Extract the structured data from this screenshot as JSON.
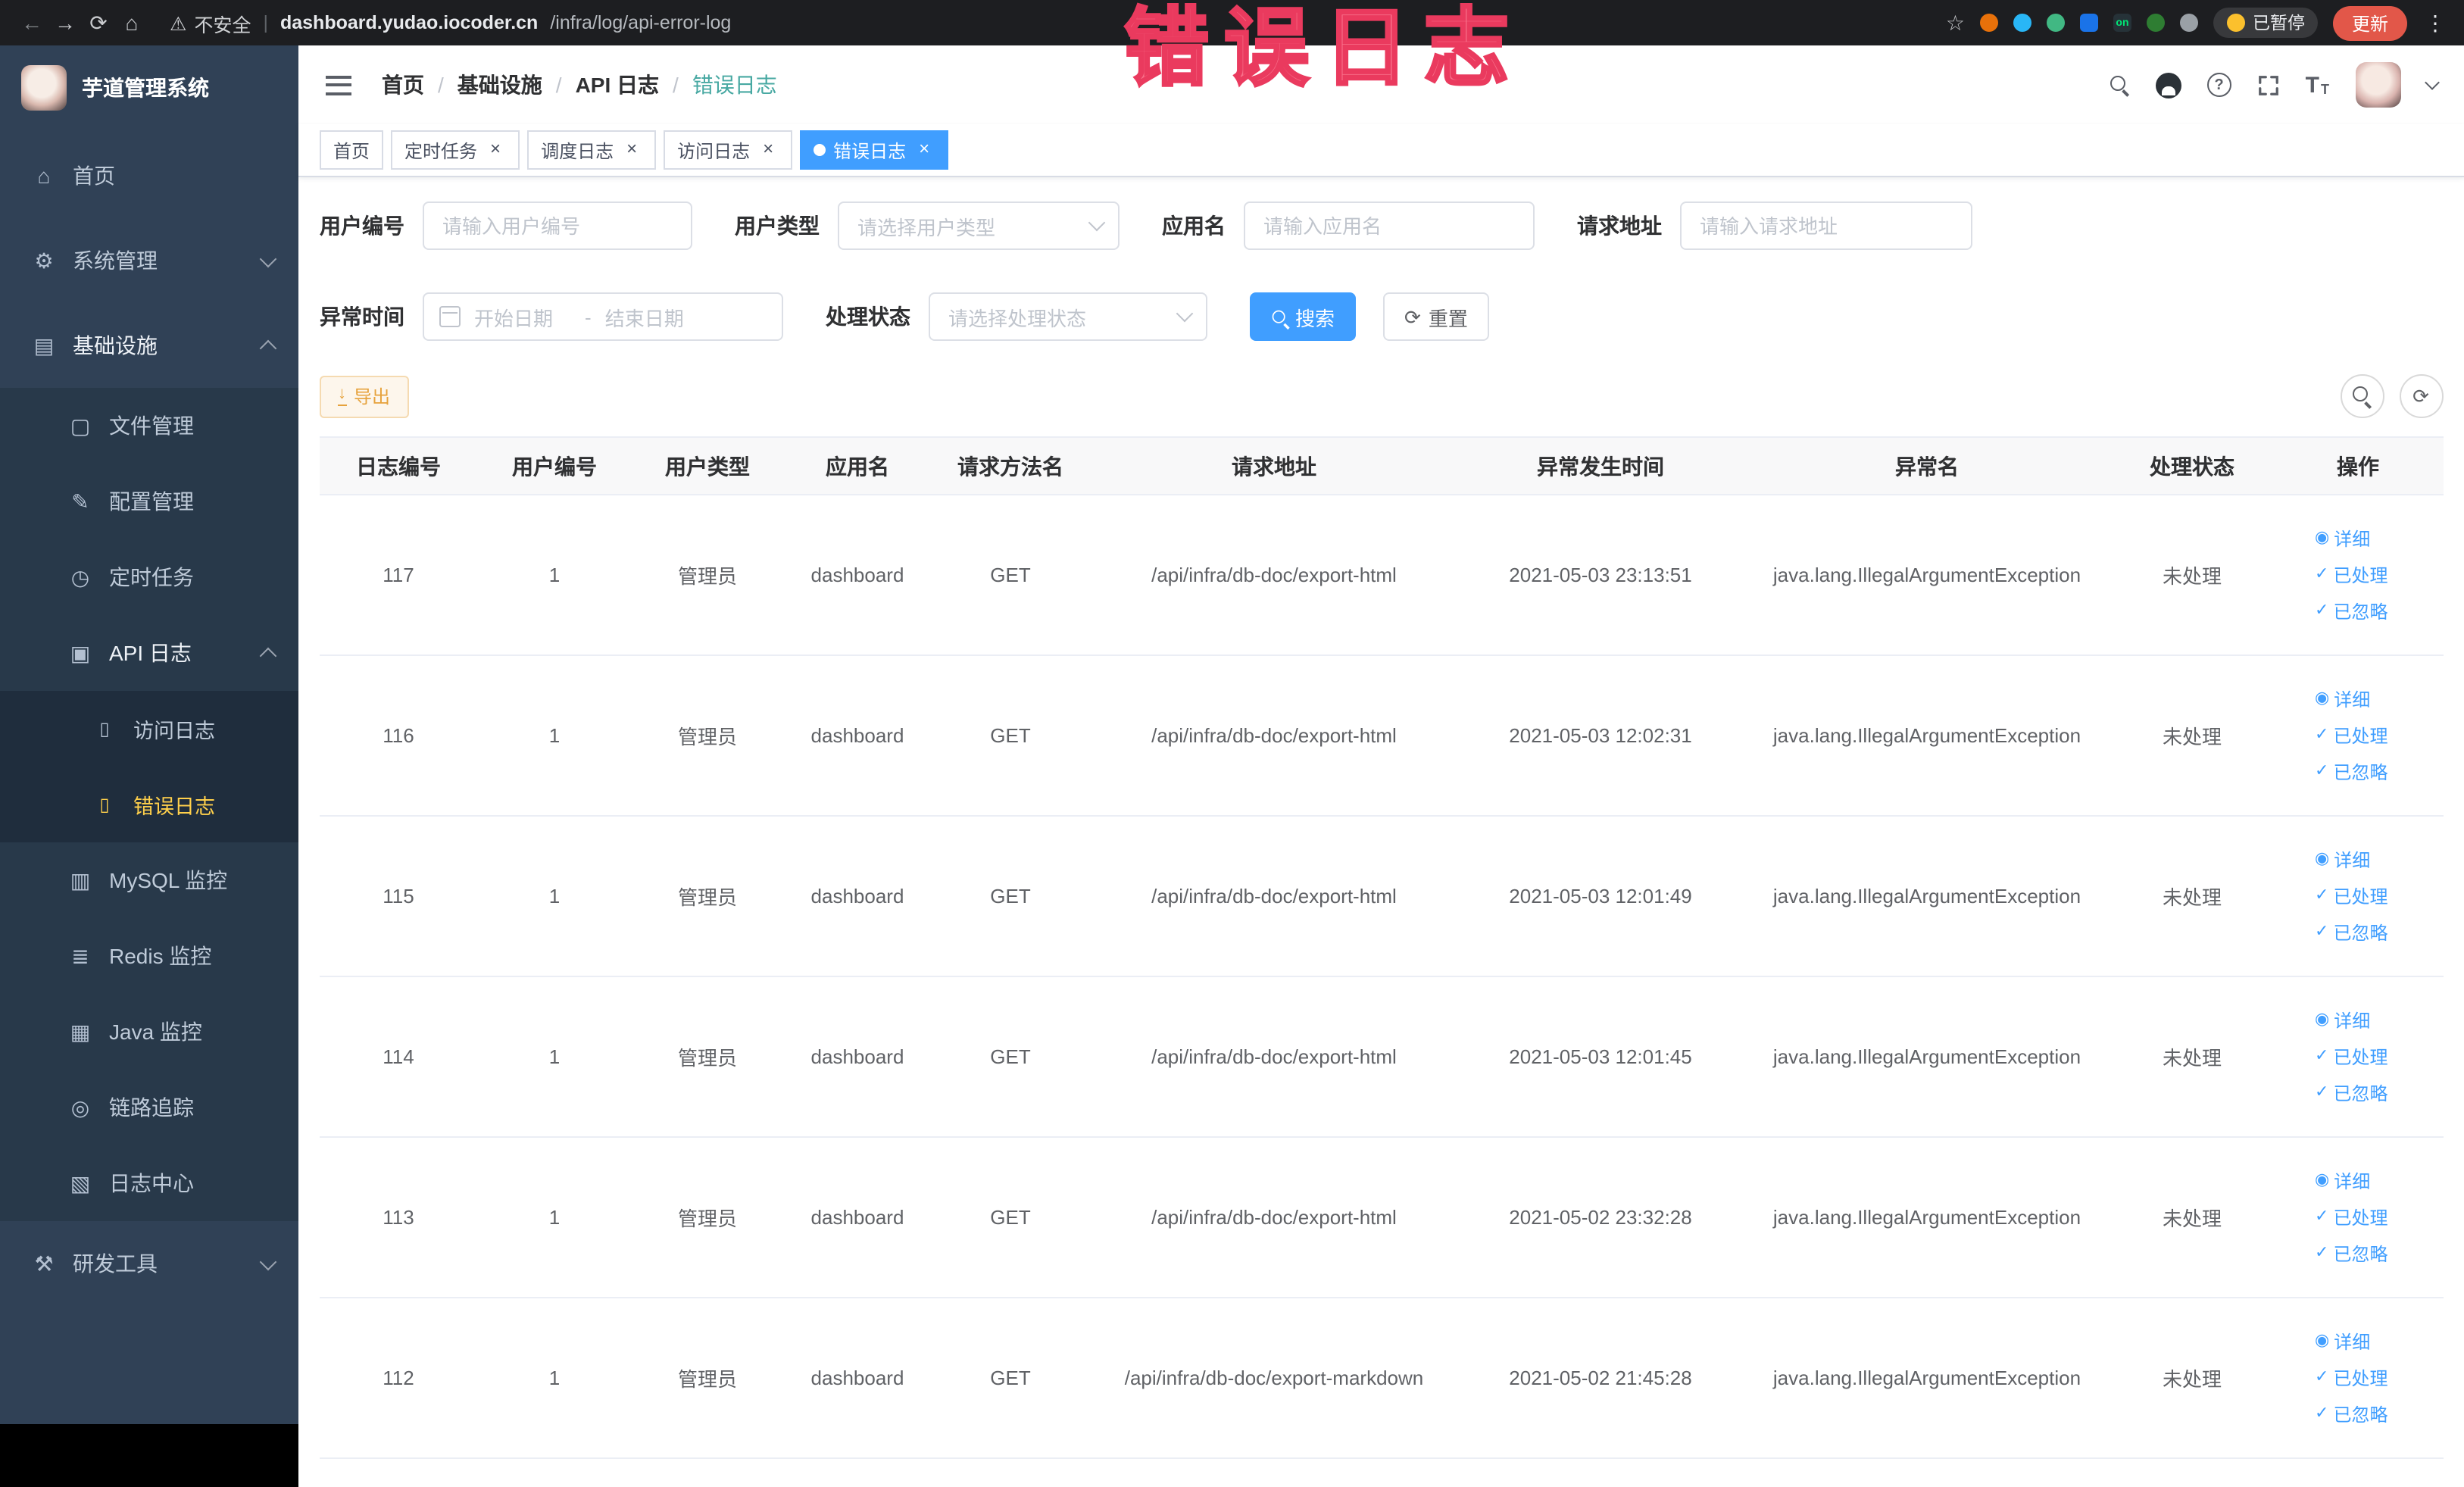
{
  "annotation": {
    "text": "错误日志"
  },
  "browser": {
    "security_label": "不安全",
    "url_host": "dashboard.yudao.iocoder.cn",
    "url_path": "/infra/log/api-error-log",
    "paused_badge": "已暂停",
    "update_button": "更新"
  },
  "icons": {
    "back": "←",
    "forward": "→",
    "reload": "⟳",
    "home": "⌂",
    "warning": "⚠",
    "star": "☆",
    "kebab": "⋮",
    "question": "?",
    "font_size_large": "T",
    "font_size_small": "T",
    "on_badge": "on",
    "menu_home": "⌂",
    "menu_system": "⚙",
    "menu_infra": "▤",
    "menu_file": "▢",
    "menu_config": "✎",
    "menu_job": "◷",
    "menu_api": "▣",
    "menu_doc": "▯",
    "menu_mysql": "▥",
    "menu_redis": "≣",
    "menu_java": "▦",
    "menu_trace": "◎",
    "menu_logcenter": "▧",
    "menu_dev": "⚒",
    "refresh": "⟳",
    "check": "✓",
    "eye": "◉",
    "close": "×",
    "download": "↓"
  },
  "sidebar": {
    "app_title": "芋道管理系统",
    "items": {
      "home": "首页",
      "system": "系统管理",
      "infra": "基础设施",
      "file": "文件管理",
      "config": "配置管理",
      "job": "定时任务",
      "api_log": "API 日志",
      "access_log": "访问日志",
      "error_log": "错误日志",
      "mysql": "MySQL 监控",
      "redis": "Redis 监控",
      "java": "Java 监控",
      "trace": "链路追踪",
      "log_center": "日志中心",
      "dev": "研发工具"
    }
  },
  "breadcrumb": {
    "separator": "/",
    "items": [
      "首页",
      "基础设施",
      "API 日志",
      "错误日志"
    ]
  },
  "tabs": [
    {
      "label": "首页"
    },
    {
      "label": "定时任务"
    },
    {
      "label": "调度日志"
    },
    {
      "label": "访问日志"
    },
    {
      "label": "错误日志"
    }
  ],
  "filters": {
    "user_id_label": "用户编号",
    "user_id_placeholder": "请输入用户编号",
    "user_type_label": "用户类型",
    "user_type_placeholder": "请选择用户类型",
    "app_name_label": "应用名",
    "app_name_placeholder": "请输入应用名",
    "request_url_label": "请求地址",
    "request_url_placeholder": "请输入请求地址",
    "exception_time_label": "异常时间",
    "date_start_placeholder": "开始日期",
    "date_separator": "-",
    "date_end_placeholder": "结束日期",
    "process_status_label": "处理状态",
    "process_status_placeholder": "请选择处理状态",
    "search_button": "搜索",
    "reset_button": "重置"
  },
  "toolbar": {
    "export_button": "导出"
  },
  "table": {
    "columns": [
      "日志编号",
      "用户编号",
      "用户类型",
      "应用名",
      "请求方法名",
      "请求地址",
      "异常发生时间",
      "异常名",
      "处理状态",
      "操作"
    ],
    "actions": [
      "详细",
      "已处理",
      "已忽略"
    ],
    "rows": [
      {
        "id": "117",
        "user_id": "1",
        "user_type": "管理员",
        "app": "dashboard",
        "method": "GET",
        "url": "/api/infra/db-doc/export-html",
        "time": "2021-05-03 23:13:51",
        "exception": "java.lang.IllegalArgumentException",
        "status": "未处理"
      },
      {
        "id": "116",
        "user_id": "1",
        "user_type": "管理员",
        "app": "dashboard",
        "method": "GET",
        "url": "/api/infra/db-doc/export-html",
        "time": "2021-05-03 12:02:31",
        "exception": "java.lang.IllegalArgumentException",
        "status": "未处理"
      },
      {
        "id": "115",
        "user_id": "1",
        "user_type": "管理员",
        "app": "dashboard",
        "method": "GET",
        "url": "/api/infra/db-doc/export-html",
        "time": "2021-05-03 12:01:49",
        "exception": "java.lang.IllegalArgumentException",
        "status": "未处理"
      },
      {
        "id": "114",
        "user_id": "1",
        "user_type": "管理员",
        "app": "dashboard",
        "method": "GET",
        "url": "/api/infra/db-doc/export-html",
        "time": "2021-05-03 12:01:45",
        "exception": "java.lang.IllegalArgumentException",
        "status": "未处理"
      },
      {
        "id": "113",
        "user_id": "1",
        "user_type": "管理员",
        "app": "dashboard",
        "method": "GET",
        "url": "/api/infra/db-doc/export-html",
        "time": "2021-05-02 23:32:28",
        "exception": "java.lang.IllegalArgumentException",
        "status": "未处理"
      },
      {
        "id": "112",
        "user_id": "1",
        "user_type": "管理员",
        "app": "dashboard",
        "method": "GET",
        "url": "/api/infra/db-doc/export-markdown",
        "time": "2021-05-02 21:45:28",
        "exception": "java.lang.IllegalArgumentException",
        "status": "未处理"
      }
    ]
  },
  "colors": {
    "primary": "#409eff",
    "sidebar_bg": "#304156",
    "active_menu_text": "#ffd04b",
    "warning": "#e6a23c",
    "annotation_pink": "#ea3a5e"
  }
}
